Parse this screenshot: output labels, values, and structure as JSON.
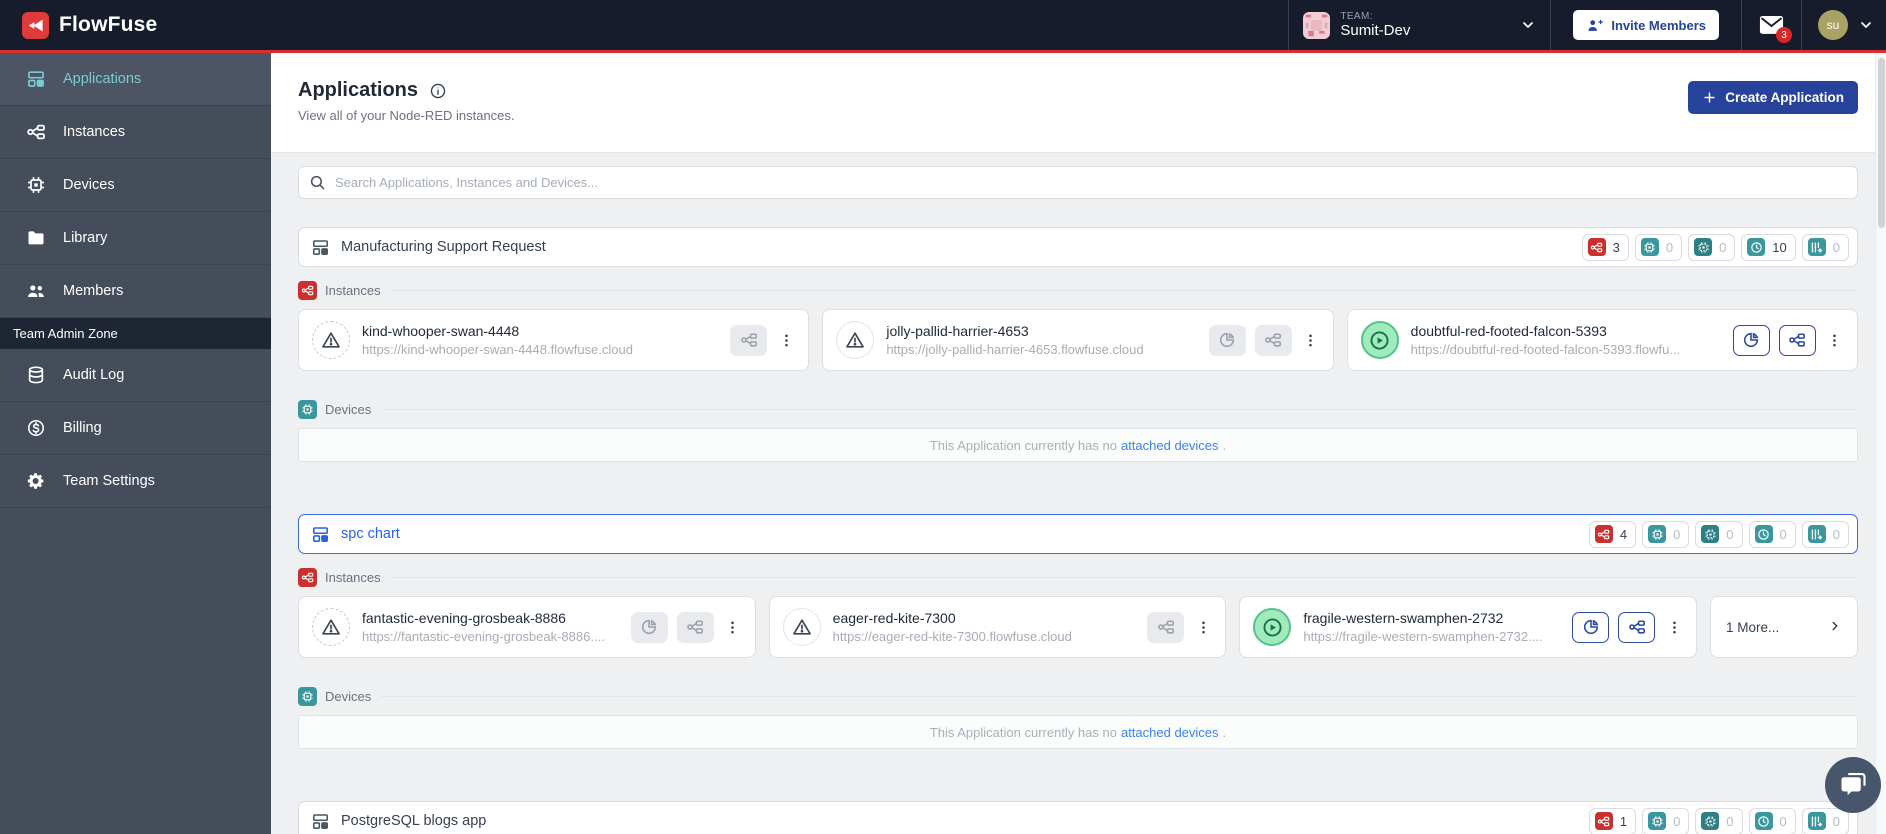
{
  "colors": {
    "navbar_bg": "#161c2b",
    "accent_red": "#d92e2e",
    "sidebar_bg": "#454c5a",
    "sidebar_active_text": "#79ccd1",
    "primary_blue": "#27429a",
    "selected_blue": "#2563eb",
    "badge_instances": "#c9302f",
    "badge_devices": "#3a979d",
    "badge_device_group": "#2f8084",
    "badge_snapshots": "#3a979d",
    "badge_pipelines": "#3a979d",
    "running_green": "#a0eabc",
    "link_blue": "#3b82f6"
  },
  "navbar": {
    "brand": "FlowFuse",
    "team_label": "TEAM:",
    "team_name": "Sumit-Dev",
    "invite_label": "Invite Members",
    "notification_count": "3",
    "avatar_initials": "su"
  },
  "sidebar": {
    "items": [
      {
        "id": "applications",
        "label": "Applications",
        "icon": "grid",
        "active": true
      },
      {
        "id": "instances",
        "label": "Instances",
        "icon": "node",
        "active": false
      },
      {
        "id": "devices",
        "label": "Devices",
        "icon": "chip",
        "active": false
      },
      {
        "id": "library",
        "label": "Library",
        "icon": "folder",
        "active": false
      },
      {
        "id": "members",
        "label": "Members",
        "icon": "users",
        "active": false
      }
    ],
    "admin_label": "Team Admin Zone",
    "admin_items": [
      {
        "id": "audit-log",
        "label": "Audit Log",
        "icon": "db",
        "active": false
      },
      {
        "id": "billing",
        "label": "Billing",
        "icon": "dollar",
        "active": false
      },
      {
        "id": "team-settings",
        "label": "Team Settings",
        "icon": "gear",
        "active": false
      }
    ]
  },
  "header": {
    "title": "Applications",
    "subtitle": "View all of your Node-RED instances.",
    "create_label": "Create Application"
  },
  "search": {
    "placeholder": "Search Applications, Instances and Devices..."
  },
  "section_labels": {
    "instances": "Instances",
    "devices": "Devices"
  },
  "devices_empty": {
    "pre": "This Application currently has no",
    "link": "attached devices",
    "post": "."
  },
  "applications": [
    {
      "name": "Manufacturing Support Request",
      "selected": false,
      "header_only": false,
      "badges": [
        {
          "kind": "instances",
          "count": "3"
        },
        {
          "kind": "devices",
          "count": "0"
        },
        {
          "kind": "device-group",
          "count": "0"
        },
        {
          "kind": "snapshots",
          "count": "10"
        },
        {
          "kind": "pipelines",
          "count": "0"
        }
      ],
      "instances": [
        {
          "name": "kind-whooper-swan-4448",
          "url": "https://kind-whooper-swan-4448.flowfuse.cloud",
          "status": "error",
          "dashed": true,
          "actions": [
            "node"
          ],
          "action_style": "gray"
        },
        {
          "name": "jolly-pallid-harrier-4653",
          "url": "https://jolly-pallid-harrier-4653.flowfuse.cloud",
          "status": "error",
          "dashed": false,
          "actions": [
            "pie",
            "node"
          ],
          "action_style": "gray"
        },
        {
          "name": "doubtful-red-footed-falcon-5393",
          "url": "https://doubtful-red-footed-falcon-5393.flowfu...",
          "status": "running",
          "dashed": false,
          "actions": [
            "pie",
            "node"
          ],
          "action_style": "blue"
        }
      ],
      "more": null
    },
    {
      "name": "spc chart",
      "selected": true,
      "header_only": false,
      "badges": [
        {
          "kind": "instances",
          "count": "4"
        },
        {
          "kind": "devices",
          "count": "0"
        },
        {
          "kind": "device-group",
          "count": "0"
        },
        {
          "kind": "snapshots",
          "count": "0"
        },
        {
          "kind": "pipelines",
          "count": "0"
        }
      ],
      "instances": [
        {
          "name": "fantastic-evening-grosbeak-8886",
          "url": "https://fantastic-evening-grosbeak-8886....",
          "status": "error",
          "dashed": true,
          "actions": [
            "pie",
            "node"
          ],
          "action_style": "gray"
        },
        {
          "name": "eager-red-kite-7300",
          "url": "https://eager-red-kite-7300.flowfuse.cloud",
          "status": "error",
          "dashed": false,
          "actions": [
            "node"
          ],
          "action_style": "gray"
        },
        {
          "name": "fragile-western-swamphen-2732",
          "url": "https://fragile-western-swamphen-2732....",
          "status": "running",
          "dashed": false,
          "actions": [
            "pie",
            "node"
          ],
          "action_style": "blue"
        }
      ],
      "more": "1 More..."
    },
    {
      "name": "PostgreSQL blogs app",
      "selected": false,
      "header_only": true,
      "badges": [
        {
          "kind": "instances",
          "count": "1"
        },
        {
          "kind": "devices",
          "count": "0"
        },
        {
          "kind": "device-group",
          "count": "0"
        },
        {
          "kind": "snapshots",
          "count": "0"
        },
        {
          "kind": "pipelines",
          "count": "0"
        }
      ],
      "instances": [],
      "more": null
    }
  ]
}
